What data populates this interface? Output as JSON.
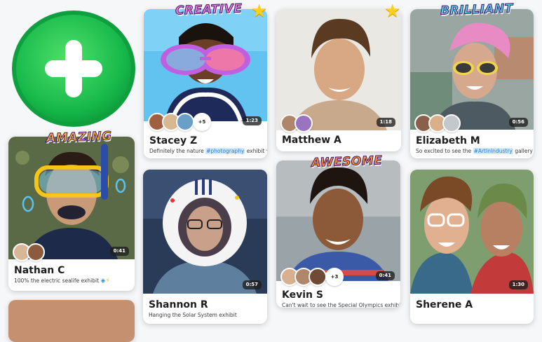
{
  "add_button": {
    "icon": "plus-icon",
    "color": "#2ec45a"
  },
  "stickers": {
    "creative": "CREATIVE",
    "brilliant": "BRILLIANT",
    "amazing": "AMAZING",
    "awesome": "AWESOME"
  },
  "cards": [
    {
      "name": "Stacey Z",
      "caption_pre": "Definitely the nature ",
      "tag": "#photography",
      "caption_post": " exhibit",
      "duration": "1:23",
      "more": "+5",
      "emoji": "leaf-icon"
    },
    {
      "name": "Matthew A",
      "duration": "1:18"
    },
    {
      "name": "Elizabeth M",
      "caption_pre": "So excited to see the ",
      "tag": "#ArtInIndustry",
      "caption_post": " gallery",
      "duration": "0:56"
    },
    {
      "name": "Nathan C",
      "caption_pre": "100% the electric sealife exhibit",
      "duration": "0:41",
      "emoji": "fish-icon"
    },
    {
      "name": "Shannon R",
      "caption_pre": "Hanging the Solar System exhibit",
      "duration": "0:57"
    },
    {
      "name": "Kevin S",
      "caption_pre": "Can't wait to see the Special Olympics exhibit",
      "duration": "0:41",
      "more": "+3",
      "emoji": "heart-icon"
    },
    {
      "name": "Sherene A",
      "duration": "1:30"
    }
  ]
}
